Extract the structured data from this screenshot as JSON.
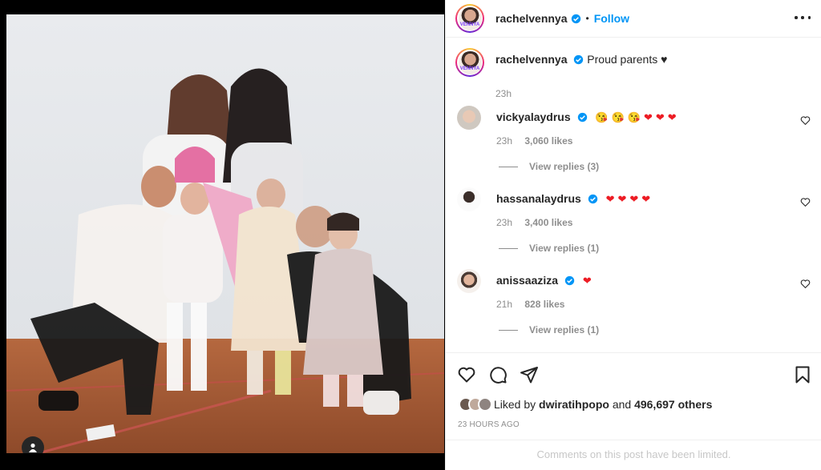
{
  "post": {
    "author": "rachelvennya",
    "follow_label": "Follow",
    "separator": "•",
    "avatar_word": "VENNYA"
  },
  "caption": {
    "username": "rachelvennya",
    "text": "Proud parents ♥",
    "time": "23h"
  },
  "comments": [
    {
      "username": "vickyalaydrus",
      "text": "😘😘😘❤❤❤",
      "time": "23h",
      "likes": "3,060 likes",
      "replies": "View replies (3)"
    },
    {
      "username": "hassanalaydrus",
      "text": "❤❤❤❤",
      "time": "23h",
      "likes": "3,400 likes",
      "replies": "View replies (1)"
    },
    {
      "username": "anissaaziza",
      "text": "❤",
      "time": "21h",
      "likes": "828 likes",
      "replies": "View replies (1)"
    }
  ],
  "likes_summary": {
    "prefix": "Liked by",
    "user": "dwiratihpopo",
    "conjunction": "and",
    "others": "496,697 others"
  },
  "timestamp": "23 HOURS AGO",
  "comments_limited": "Comments on this post have been limited.",
  "colors": {
    "accent": "#0095f6",
    "heart": "#ed1c24",
    "text": "#262626",
    "muted": "#8e8e8e"
  },
  "icons": [
    "user-tag-icon",
    "verified-icon",
    "more-icon",
    "heart-outline-icon",
    "comment-icon",
    "share-icon",
    "bookmark-icon"
  ]
}
